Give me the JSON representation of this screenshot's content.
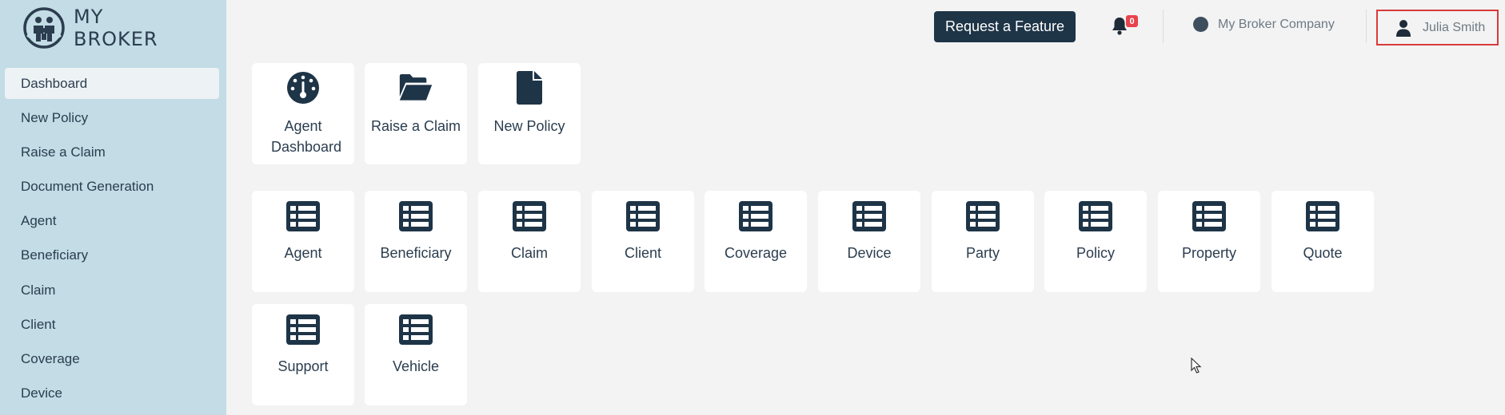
{
  "logo": {
    "line1": "MY",
    "line2": "BROKER"
  },
  "sidebar": {
    "items": [
      {
        "label": "Dashboard",
        "active": true
      },
      {
        "label": "New Policy"
      },
      {
        "label": "Raise a Claim"
      },
      {
        "label": "Document Generation"
      },
      {
        "label": "Agent"
      },
      {
        "label": "Beneficiary"
      },
      {
        "label": "Claim"
      },
      {
        "label": "Client"
      },
      {
        "label": "Coverage"
      },
      {
        "label": "Device"
      }
    ]
  },
  "header": {
    "request_feature_label": "Request a Feature",
    "notification_count": "0",
    "company_name": "My Broker Company",
    "user_name": "Julia Smith"
  },
  "quick_actions": [
    {
      "label": "Agent Dashboard",
      "icon": "gauge-icon"
    },
    {
      "label": "Raise a Claim",
      "icon": "folder-open-icon"
    },
    {
      "label": "New Policy",
      "icon": "file-icon"
    }
  ],
  "entities": [
    {
      "label": "Agent",
      "icon": "table-list-icon"
    },
    {
      "label": "Beneficiary",
      "icon": "table-list-icon"
    },
    {
      "label": "Claim",
      "icon": "table-list-icon"
    },
    {
      "label": "Client",
      "icon": "table-list-icon"
    },
    {
      "label": "Coverage",
      "icon": "table-list-icon"
    },
    {
      "label": "Device",
      "icon": "table-list-icon"
    },
    {
      "label": "Party",
      "icon": "table-list-icon"
    },
    {
      "label": "Policy",
      "icon": "table-list-icon"
    },
    {
      "label": "Property",
      "icon": "table-list-icon"
    },
    {
      "label": "Quote",
      "icon": "table-list-icon"
    },
    {
      "label": "Support",
      "icon": "table-list-icon"
    },
    {
      "label": "Vehicle",
      "icon": "table-list-icon"
    }
  ],
  "colors": {
    "sidebar_bg": "#c3dce5",
    "primary_dark": "#1e3447",
    "badge_red": "#e8434c",
    "highlight_border": "#d93a3a"
  }
}
